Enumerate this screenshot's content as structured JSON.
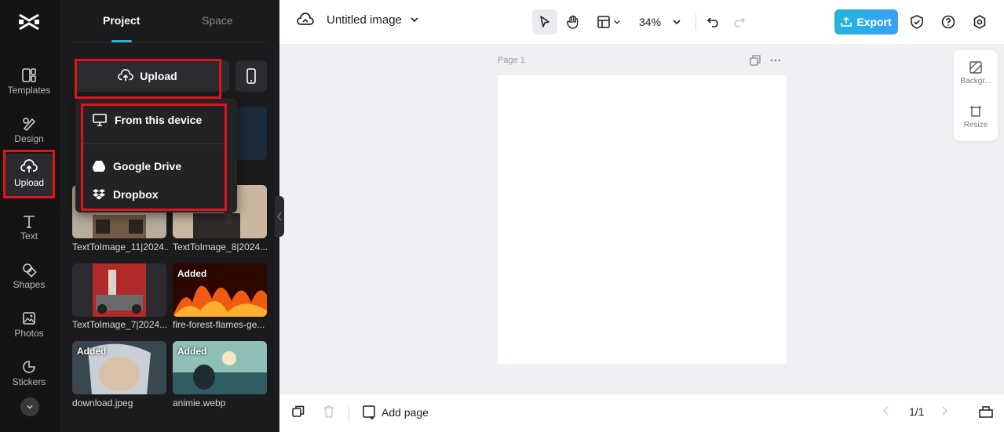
{
  "rail": {
    "items": [
      {
        "label": "Templates",
        "icon": "templates-icon"
      },
      {
        "label": "Design",
        "icon": "design-icon"
      },
      {
        "label": "Upload",
        "icon": "upload-cloud-icon",
        "active": true
      },
      {
        "label": "Text",
        "icon": "text-icon"
      },
      {
        "label": "Shapes",
        "icon": "shapes-icon"
      },
      {
        "label": "Photos",
        "icon": "photos-icon"
      },
      {
        "label": "Stickers",
        "icon": "stickers-icon"
      }
    ]
  },
  "panel": {
    "tabs": [
      "Project",
      "Space"
    ],
    "upload_label": "Upload",
    "dropdown": {
      "items": [
        "From this device",
        "Google Drive",
        "Dropbox"
      ]
    },
    "assets": [
      {
        "name": "TextToImage_11|2024...",
        "added": ""
      },
      {
        "name": "TextToImage_8|2024...",
        "added": ""
      },
      {
        "name": "TextToImage_7|2024...",
        "added": ""
      },
      {
        "name": "fire-forest-flames-ge...",
        "added": "Added"
      },
      {
        "name": "download.jpeg",
        "added": "Added"
      },
      {
        "name": "animie.webp",
        "added": "Added"
      }
    ]
  },
  "topbar": {
    "title": "Untitled image",
    "zoom": "34%",
    "export_label": "Export"
  },
  "canvas": {
    "page_label": "Page 1",
    "side_tools": [
      "Backgr...",
      "Resize"
    ]
  },
  "bottombar": {
    "add_page": "Add page",
    "pagination": "1/1"
  },
  "colors": {
    "accent": "#1ea7e8",
    "highlight": "#e0141e"
  }
}
